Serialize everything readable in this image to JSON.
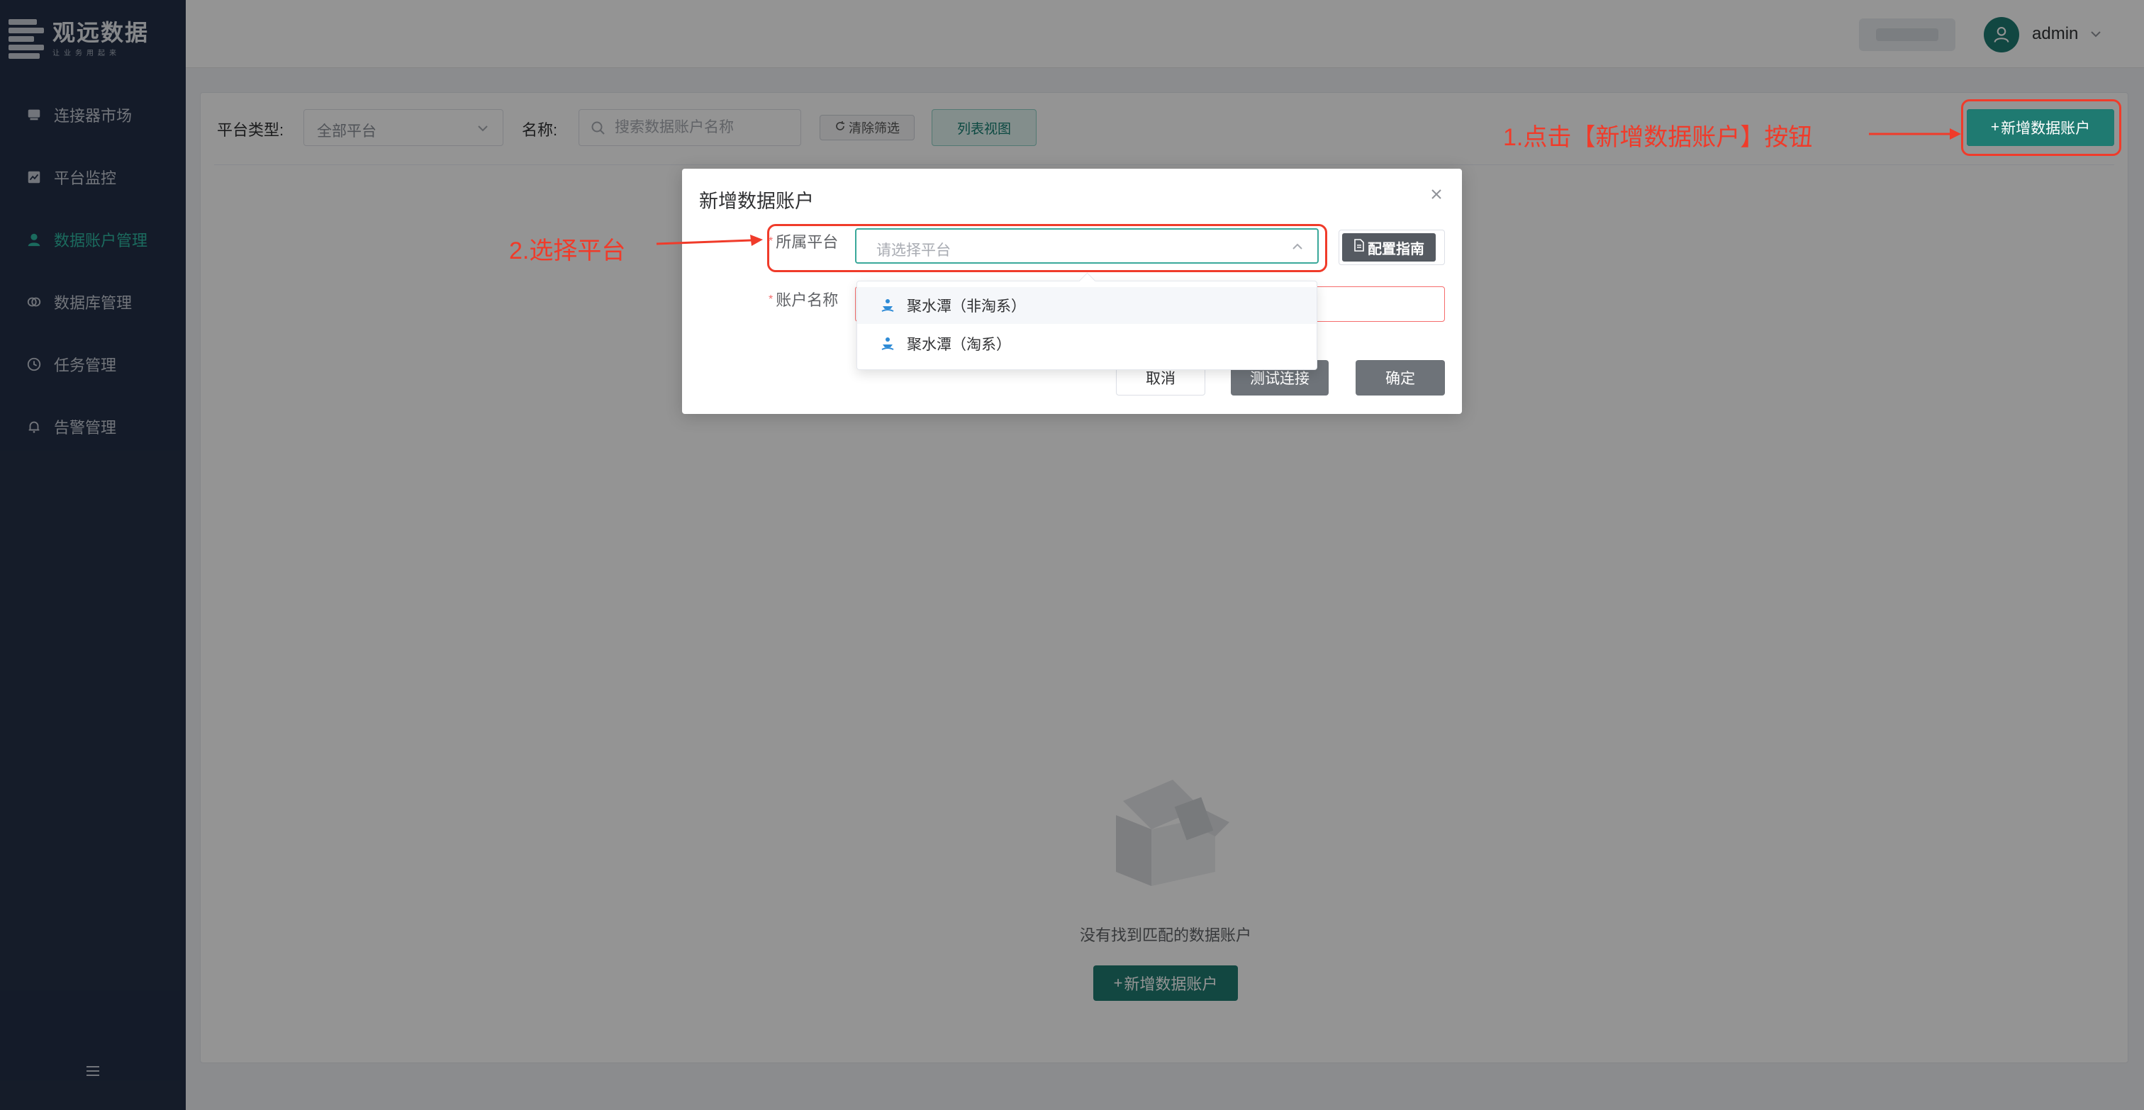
{
  "brand": {
    "name": "观远数据",
    "tagline": "让业务用起来"
  },
  "sidebar": {
    "items": [
      {
        "label": "连接器市场",
        "icon": "store-icon",
        "active": false
      },
      {
        "label": "平台监控",
        "icon": "chart-icon",
        "active": false
      },
      {
        "label": "数据账户管理",
        "icon": "user-icon",
        "active": true
      },
      {
        "label": "数据库管理",
        "icon": "database-icon",
        "active": false
      },
      {
        "label": "任务管理",
        "icon": "clock-icon",
        "active": false
      },
      {
        "label": "告警管理",
        "icon": "bell-icon",
        "active": false
      }
    ],
    "collapse_icon": "menu-collapse-icon"
  },
  "header": {
    "user": "admin"
  },
  "filters": {
    "platform_type_label": "平台类型:",
    "platform_type_value": "全部平台",
    "name_label": "名称:",
    "search_placeholder": "搜索数据账户名称",
    "clear_button": "清除筛选",
    "list_view_button": "列表视图"
  },
  "toolbar": {
    "add_account_button": "新增数据账户"
  },
  "empty_state": {
    "message": "没有找到匹配的数据账户",
    "add_button": "新增数据账户"
  },
  "dialog": {
    "title": "新增数据账户",
    "platform_label": "所属平台",
    "platform_placeholder": "请选择平台",
    "guide_button": "配置指南",
    "account_name_label": "账户名称",
    "cancel": "取消",
    "test_connection": "测试连接",
    "confirm": "确定",
    "platform_options": [
      "聚水潭（非淘系）",
      "聚水潭（淘系）"
    ]
  },
  "annotations": {
    "step1": "1.点击【新增数据账户】按钮",
    "step2": "2.选择平台"
  },
  "colors": {
    "primary": "#1f7a71",
    "annotation": "#f03b2a",
    "sidebar_bg": "#243047",
    "active_nav": "#2fb8a3"
  }
}
